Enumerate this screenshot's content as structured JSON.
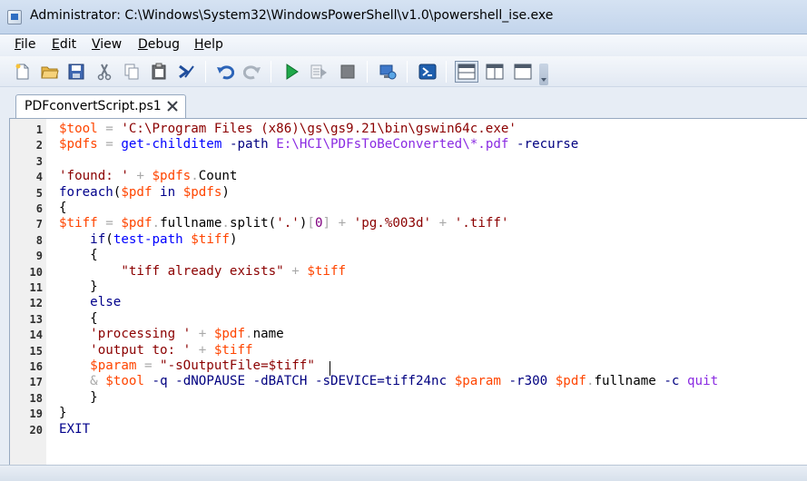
{
  "window": {
    "title": "Administrator: C:\\Windows\\System32\\WindowsPowerShell\\v1.0\\powershell_ise.exe"
  },
  "menu": [
    {
      "key": "F",
      "rest": "ile"
    },
    {
      "key": "E",
      "rest": "dit"
    },
    {
      "key": "V",
      "rest": "iew"
    },
    {
      "key": "D",
      "rest": "ebug"
    },
    {
      "key": "H",
      "rest": "elp"
    }
  ],
  "toolbar": {
    "icons": [
      "new-file-icon",
      "open-folder-icon",
      "save-icon",
      "cut-icon",
      "copy-icon",
      "paste-icon",
      "clear-output-icon",
      "undo-icon",
      "redo-icon",
      "run-icon",
      "run-selection-icon",
      "stop-icon",
      "new-remote-tab-icon",
      "start-powershell-icon",
      "layout-top-icon",
      "layout-side-icon",
      "layout-max-icon"
    ]
  },
  "tab": {
    "label": "PDFconvertScript.ps1"
  },
  "editor": {
    "lines": [
      {
        "n": "1",
        "tokens": [
          [
            "var",
            "$tool"
          ],
          [
            "op",
            " = "
          ],
          [
            "str",
            "'C:\\Program Files (x86)\\gs\\gs9.21\\bin\\gswin64c.exe'"
          ]
        ]
      },
      {
        "n": "2",
        "tokens": [
          [
            "var",
            "$pdfs"
          ],
          [
            "op",
            " = "
          ],
          [
            "cmd",
            "get-childitem"
          ],
          [
            "pun",
            " "
          ],
          [
            "param",
            "-path"
          ],
          [
            "pun",
            " "
          ],
          [
            "arg",
            "E:\\HCI\\PDFsToBeConverted\\*.pdf"
          ],
          [
            "pun",
            " "
          ],
          [
            "param",
            "-recurse"
          ]
        ]
      },
      {
        "n": "3",
        "tokens": []
      },
      {
        "n": "4",
        "tokens": [
          [
            "str",
            "'found: '"
          ],
          [
            "op",
            " + "
          ],
          [
            "var",
            "$pdfs"
          ],
          [
            "op",
            "."
          ],
          [
            "mem",
            "Count"
          ]
        ]
      },
      {
        "n": "5",
        "tokens": [
          [
            "kw",
            "foreach"
          ],
          [
            "pun",
            "("
          ],
          [
            "var",
            "$pdf"
          ],
          [
            "kw",
            " in "
          ],
          [
            "var",
            "$pdfs"
          ],
          [
            "pun",
            ")"
          ]
        ]
      },
      {
        "n": "6",
        "tokens": [
          [
            "pun",
            "{"
          ]
        ]
      },
      {
        "n": "7",
        "tokens": [
          [
            "var",
            "$tiff"
          ],
          [
            "op",
            " = "
          ],
          [
            "var",
            "$pdf"
          ],
          [
            "op",
            "."
          ],
          [
            "mem",
            "fullname"
          ],
          [
            "op",
            "."
          ],
          [
            "mem",
            "split"
          ],
          [
            "pun",
            "("
          ],
          [
            "str",
            "'.'"
          ],
          [
            "pun",
            ")"
          ],
          [
            "op",
            "["
          ],
          [
            "num",
            "0"
          ],
          [
            "op",
            "]"
          ],
          [
            "op",
            " + "
          ],
          [
            "str",
            "'pg.%003d'"
          ],
          [
            "op",
            " + "
          ],
          [
            "str",
            "'.tiff'"
          ]
        ]
      },
      {
        "n": "8",
        "tokens": [
          [
            "pun",
            "    "
          ],
          [
            "kw",
            "if"
          ],
          [
            "pun",
            "("
          ],
          [
            "cmd",
            "test-path"
          ],
          [
            "pun",
            " "
          ],
          [
            "var",
            "$tiff"
          ],
          [
            "pun",
            ")"
          ]
        ]
      },
      {
        "n": "9",
        "tokens": [
          [
            "pun",
            "    {"
          ]
        ]
      },
      {
        "n": "10",
        "tokens": [
          [
            "pun",
            "        "
          ],
          [
            "str",
            "\"tiff already exists\""
          ],
          [
            "op",
            " + "
          ],
          [
            "var",
            "$tiff"
          ]
        ]
      },
      {
        "n": "11",
        "tokens": [
          [
            "pun",
            "    }"
          ]
        ]
      },
      {
        "n": "12",
        "tokens": [
          [
            "pun",
            "    "
          ],
          [
            "kw",
            "else"
          ]
        ]
      },
      {
        "n": "13",
        "tokens": [
          [
            "pun",
            "    {"
          ]
        ]
      },
      {
        "n": "14",
        "tokens": [
          [
            "pun",
            "    "
          ],
          [
            "str",
            "'processing '"
          ],
          [
            "op",
            " + "
          ],
          [
            "var",
            "$pdf"
          ],
          [
            "op",
            "."
          ],
          [
            "mem",
            "name"
          ]
        ]
      },
      {
        "n": "15",
        "tokens": [
          [
            "pun",
            "    "
          ],
          [
            "str",
            "'output to: '"
          ],
          [
            "op",
            " + "
          ],
          [
            "var",
            "$tiff"
          ]
        ]
      },
      {
        "n": "16",
        "tokens": [
          [
            "pun",
            "    "
          ],
          [
            "var",
            "$param"
          ],
          [
            "op",
            " = "
          ],
          [
            "str",
            "\"-sOutputFile=$tiff\""
          ]
        ]
      },
      {
        "n": "17",
        "tokens": [
          [
            "pun",
            "    "
          ],
          [
            "op",
            "& "
          ],
          [
            "var",
            "$tool"
          ],
          [
            "pun",
            " "
          ],
          [
            "param",
            "-q"
          ],
          [
            "pun",
            " "
          ],
          [
            "param",
            "-dNOPAUSE"
          ],
          [
            "pun",
            " "
          ],
          [
            "param",
            "-dBATCH"
          ],
          [
            "pun",
            " "
          ],
          [
            "param",
            "-sDEVICE=tiff24nc"
          ],
          [
            "pun",
            " "
          ],
          [
            "var",
            "$param"
          ],
          [
            "pun",
            " "
          ],
          [
            "param",
            "-r300"
          ],
          [
            "pun",
            " "
          ],
          [
            "var",
            "$pdf"
          ],
          [
            "op",
            "."
          ],
          [
            "mem",
            "fullname"
          ],
          [
            "pun",
            " "
          ],
          [
            "param",
            "-c"
          ],
          [
            "pun",
            " "
          ],
          [
            "arg",
            "quit"
          ]
        ]
      },
      {
        "n": "18",
        "tokens": [
          [
            "pun",
            "    }"
          ]
        ]
      },
      {
        "n": "19",
        "tokens": [
          [
            "pun",
            "}"
          ]
        ]
      },
      {
        "n": "20",
        "tokens": [
          [
            "kw",
            "EXIT"
          ]
        ]
      }
    ]
  },
  "colors": {
    "variable": "#ff4500",
    "string": "#8b0000",
    "command": "#0000ff",
    "parameter": "#000080",
    "operator": "#a9a9a9",
    "keyword": "#00008b",
    "number": "#800080"
  }
}
